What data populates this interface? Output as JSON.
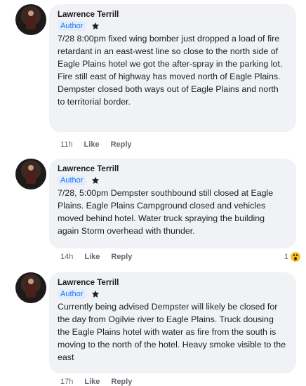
{
  "comments": [
    {
      "author": "Lawrence Terrill",
      "badge": "Author",
      "badge_icon": "author-emblem-icon",
      "text": "7/28 8:00pm fixed wing bomber just dropped a load of fire retardant in an east-west line so close to the north side of Eagle Plains hotel we got the after-spray in the parking lot. Fire still east of highway has moved north of Eagle Plains. Dempster closed both ways out of Eagle Plains and north to territorial border.",
      "time": "11h",
      "like": "Like",
      "reply": "Reply"
    },
    {
      "author": "Lawrence Terrill",
      "badge": "Author",
      "badge_icon": "author-emblem-icon",
      "text": "7/28, 5:00pm Dempster southbound still closed at Eagle Plains. Eagle Plains Campground closed and vehicles moved behind hotel. Water truck spraying the building again  Storm overhead with thunder.",
      "time": "14h",
      "like": "Like",
      "reply": "Reply",
      "reaction_count": "1",
      "reaction_icon": "wow-emoji-icon"
    },
    {
      "author": "Lawrence Terrill",
      "badge": "Author",
      "badge_icon": "author-emblem-icon",
      "text": "Currently being advised Dempster will likely be closed for the day from Ogilvie river to Eagle Plains. Truck dousing the Eagle Plains hotel with water as fire from the south is moving to the north of the hotel. Heavy smoke visible to the east",
      "time": "17h",
      "like": "Like",
      "reply": "Reply"
    }
  ]
}
